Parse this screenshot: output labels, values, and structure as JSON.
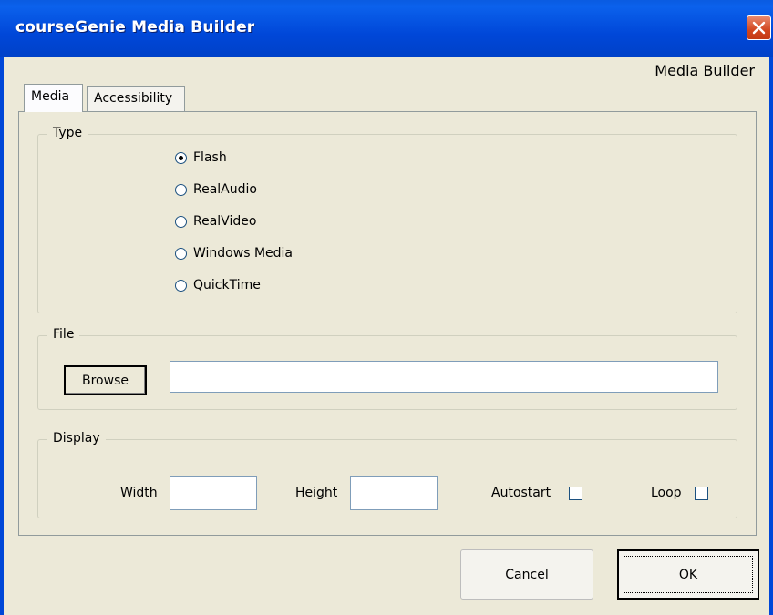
{
  "window": {
    "title": "courseGenie Media Builder"
  },
  "header": {
    "label": "Media Builder"
  },
  "tabs": [
    {
      "label": "Media",
      "active": true
    },
    {
      "label": "Accessibility",
      "active": false
    }
  ],
  "type_group": {
    "legend": "Type",
    "options": [
      {
        "label": "Flash",
        "checked": true
      },
      {
        "label": "RealAudio",
        "checked": false
      },
      {
        "label": "RealVideo",
        "checked": false
      },
      {
        "label": "Windows Media",
        "checked": false
      },
      {
        "label": "QuickTime",
        "checked": false
      }
    ]
  },
  "file_group": {
    "legend": "File",
    "browse_label": "Browse",
    "path_value": ""
  },
  "display_group": {
    "legend": "Display",
    "width_label": "Width",
    "width_value": "",
    "height_label": "Height",
    "height_value": "",
    "autostart_label": "Autostart",
    "autostart_checked": false,
    "loop_label": "Loop",
    "loop_checked": false
  },
  "buttons": {
    "cancel": "Cancel",
    "ok": "OK"
  },
  "colors": {
    "titlebar": "#0047D8",
    "dialog_bg": "#ECE9D8",
    "close_button": "#D2461F"
  }
}
